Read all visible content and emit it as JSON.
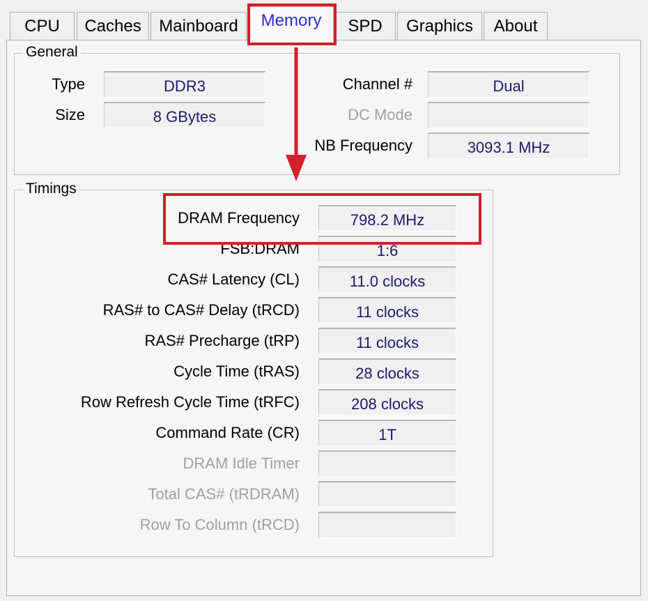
{
  "tabs": [
    {
      "label": "CPU"
    },
    {
      "label": "Caches"
    },
    {
      "label": "Mainboard"
    },
    {
      "label": "Memory",
      "active": true
    },
    {
      "label": "SPD"
    },
    {
      "label": "Graphics"
    },
    {
      "label": "About"
    }
  ],
  "general": {
    "title": "General",
    "type_label": "Type",
    "type_value": "DDR3",
    "size_label": "Size",
    "size_value": "8 GBytes",
    "channel_label": "Channel #",
    "channel_value": "Dual",
    "dc_mode_label": "DC Mode",
    "dc_mode_value": "",
    "nb_freq_label": "NB Frequency",
    "nb_freq_value": "3093.1 MHz"
  },
  "timings": {
    "title": "Timings",
    "rows": [
      {
        "label": "DRAM Frequency",
        "value": "798.2 MHz"
      },
      {
        "label": "FSB:DRAM",
        "value": "1:6"
      },
      {
        "label": "CAS# Latency (CL)",
        "value": "11.0 clocks"
      },
      {
        "label": "RAS# to CAS# Delay (tRCD)",
        "value": "11 clocks"
      },
      {
        "label": "RAS# Precharge (tRP)",
        "value": "11 clocks"
      },
      {
        "label": "Cycle Time (tRAS)",
        "value": "28 clocks"
      },
      {
        "label": "Row Refresh Cycle Time (tRFC)",
        "value": "208 clocks"
      },
      {
        "label": "Command Rate (CR)",
        "value": "1T"
      },
      {
        "label": "DRAM Idle Timer",
        "value": "",
        "disabled": true
      },
      {
        "label": "Total CAS# (tRDRAM)",
        "value": "",
        "disabled": true
      },
      {
        "label": "Row To Column (tRCD)",
        "value": "",
        "disabled": true
      }
    ]
  },
  "annotation_color": "#d3202a"
}
